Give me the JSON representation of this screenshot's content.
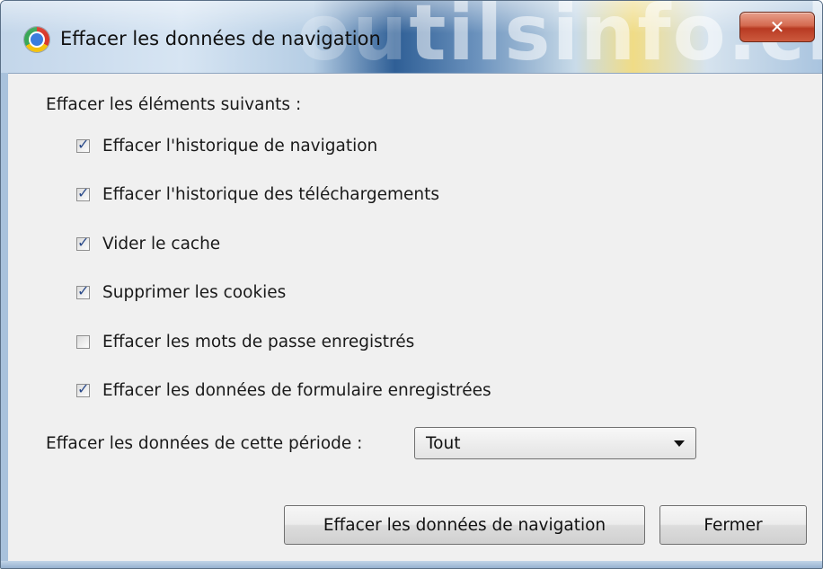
{
  "window": {
    "title": "Effacer les données de navigation",
    "close_glyph": "✕",
    "background_watermark": "outilsinfo.ch"
  },
  "dialog": {
    "section_label": "Effacer les éléments suivants :",
    "checkboxes": [
      {
        "label": "Effacer l'historique de navigation",
        "checked": true
      },
      {
        "label": "Effacer l'historique des téléchargements",
        "checked": true
      },
      {
        "label": "Vider le cache",
        "checked": true
      },
      {
        "label": "Supprimer les cookies",
        "checked": true
      },
      {
        "label": "Effacer les mots de passe enregistrés",
        "checked": false
      },
      {
        "label": "Effacer les données de formulaire enregistrées",
        "checked": true
      }
    ],
    "period_label": "Effacer les données de cette période :",
    "period_value": "Tout",
    "clear_button": "Effacer les données de navigation",
    "close_button": "Fermer"
  },
  "colors": {
    "client_bg": "#f0f0f0",
    "close_button_red": "#c84a30",
    "check_blue": "#2a4a8a"
  },
  "icons": {
    "app": "chrome-logo-icon",
    "close": "close-x-icon",
    "dropdown": "dropdown-arrow-icon"
  }
}
